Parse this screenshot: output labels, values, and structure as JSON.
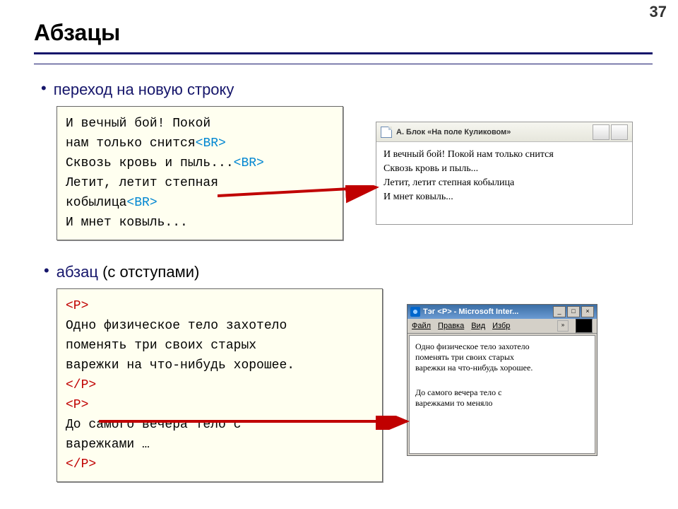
{
  "slide": {
    "number": "37",
    "title": "Абзацы"
  },
  "bullets": {
    "b1": "переход на новую строку",
    "b2_pre": "абзац ",
    "b2_post": "(с отступами)"
  },
  "code1": {
    "l1": "И вечный бой! Покой",
    "l2a": "нам только снится",
    "br": "<BR>",
    "l3a": "Сквозь кровь и пыль...",
    "l4": "Летит, летит степная",
    "l5a": "кобылица",
    "l6": "И мнет ковыль..."
  },
  "code2": {
    "pOpen": "<P>",
    "l1": "Одно физическое тело захотело",
    "l2": "поменять три своих старых",
    "l3": "варежки на что-нибудь хорошее.",
    "pClose": "</P>",
    "l4": "До самого вечера тело с",
    "l5": "варежками …"
  },
  "browserA": {
    "title": "А. Блок «На поле Куликовом»",
    "line1": "И вечный бой! Покой нам только снится",
    "line2": "Сквозь кровь и пыль...",
    "line3": "Летит, летит степная кобылица",
    "line4": "И мнет ковыль..."
  },
  "browserB": {
    "title": "Тэг <P> - Microsoft Inter...",
    "menu": {
      "file": "Файл",
      "edit": "Правка",
      "view": "Вид",
      "fav": "Избр"
    },
    "win": {
      "min": "_",
      "max": "□",
      "close": "×",
      "chev": "»"
    },
    "para1_l1": "Одно физическое тело захотело",
    "para1_l2": "поменять три своих старых",
    "para1_l3": "варежки на что-нибудь хорошее.",
    "para2_l1": "До самого вечера тело с",
    "para2_l2": "варежками то меняло"
  }
}
